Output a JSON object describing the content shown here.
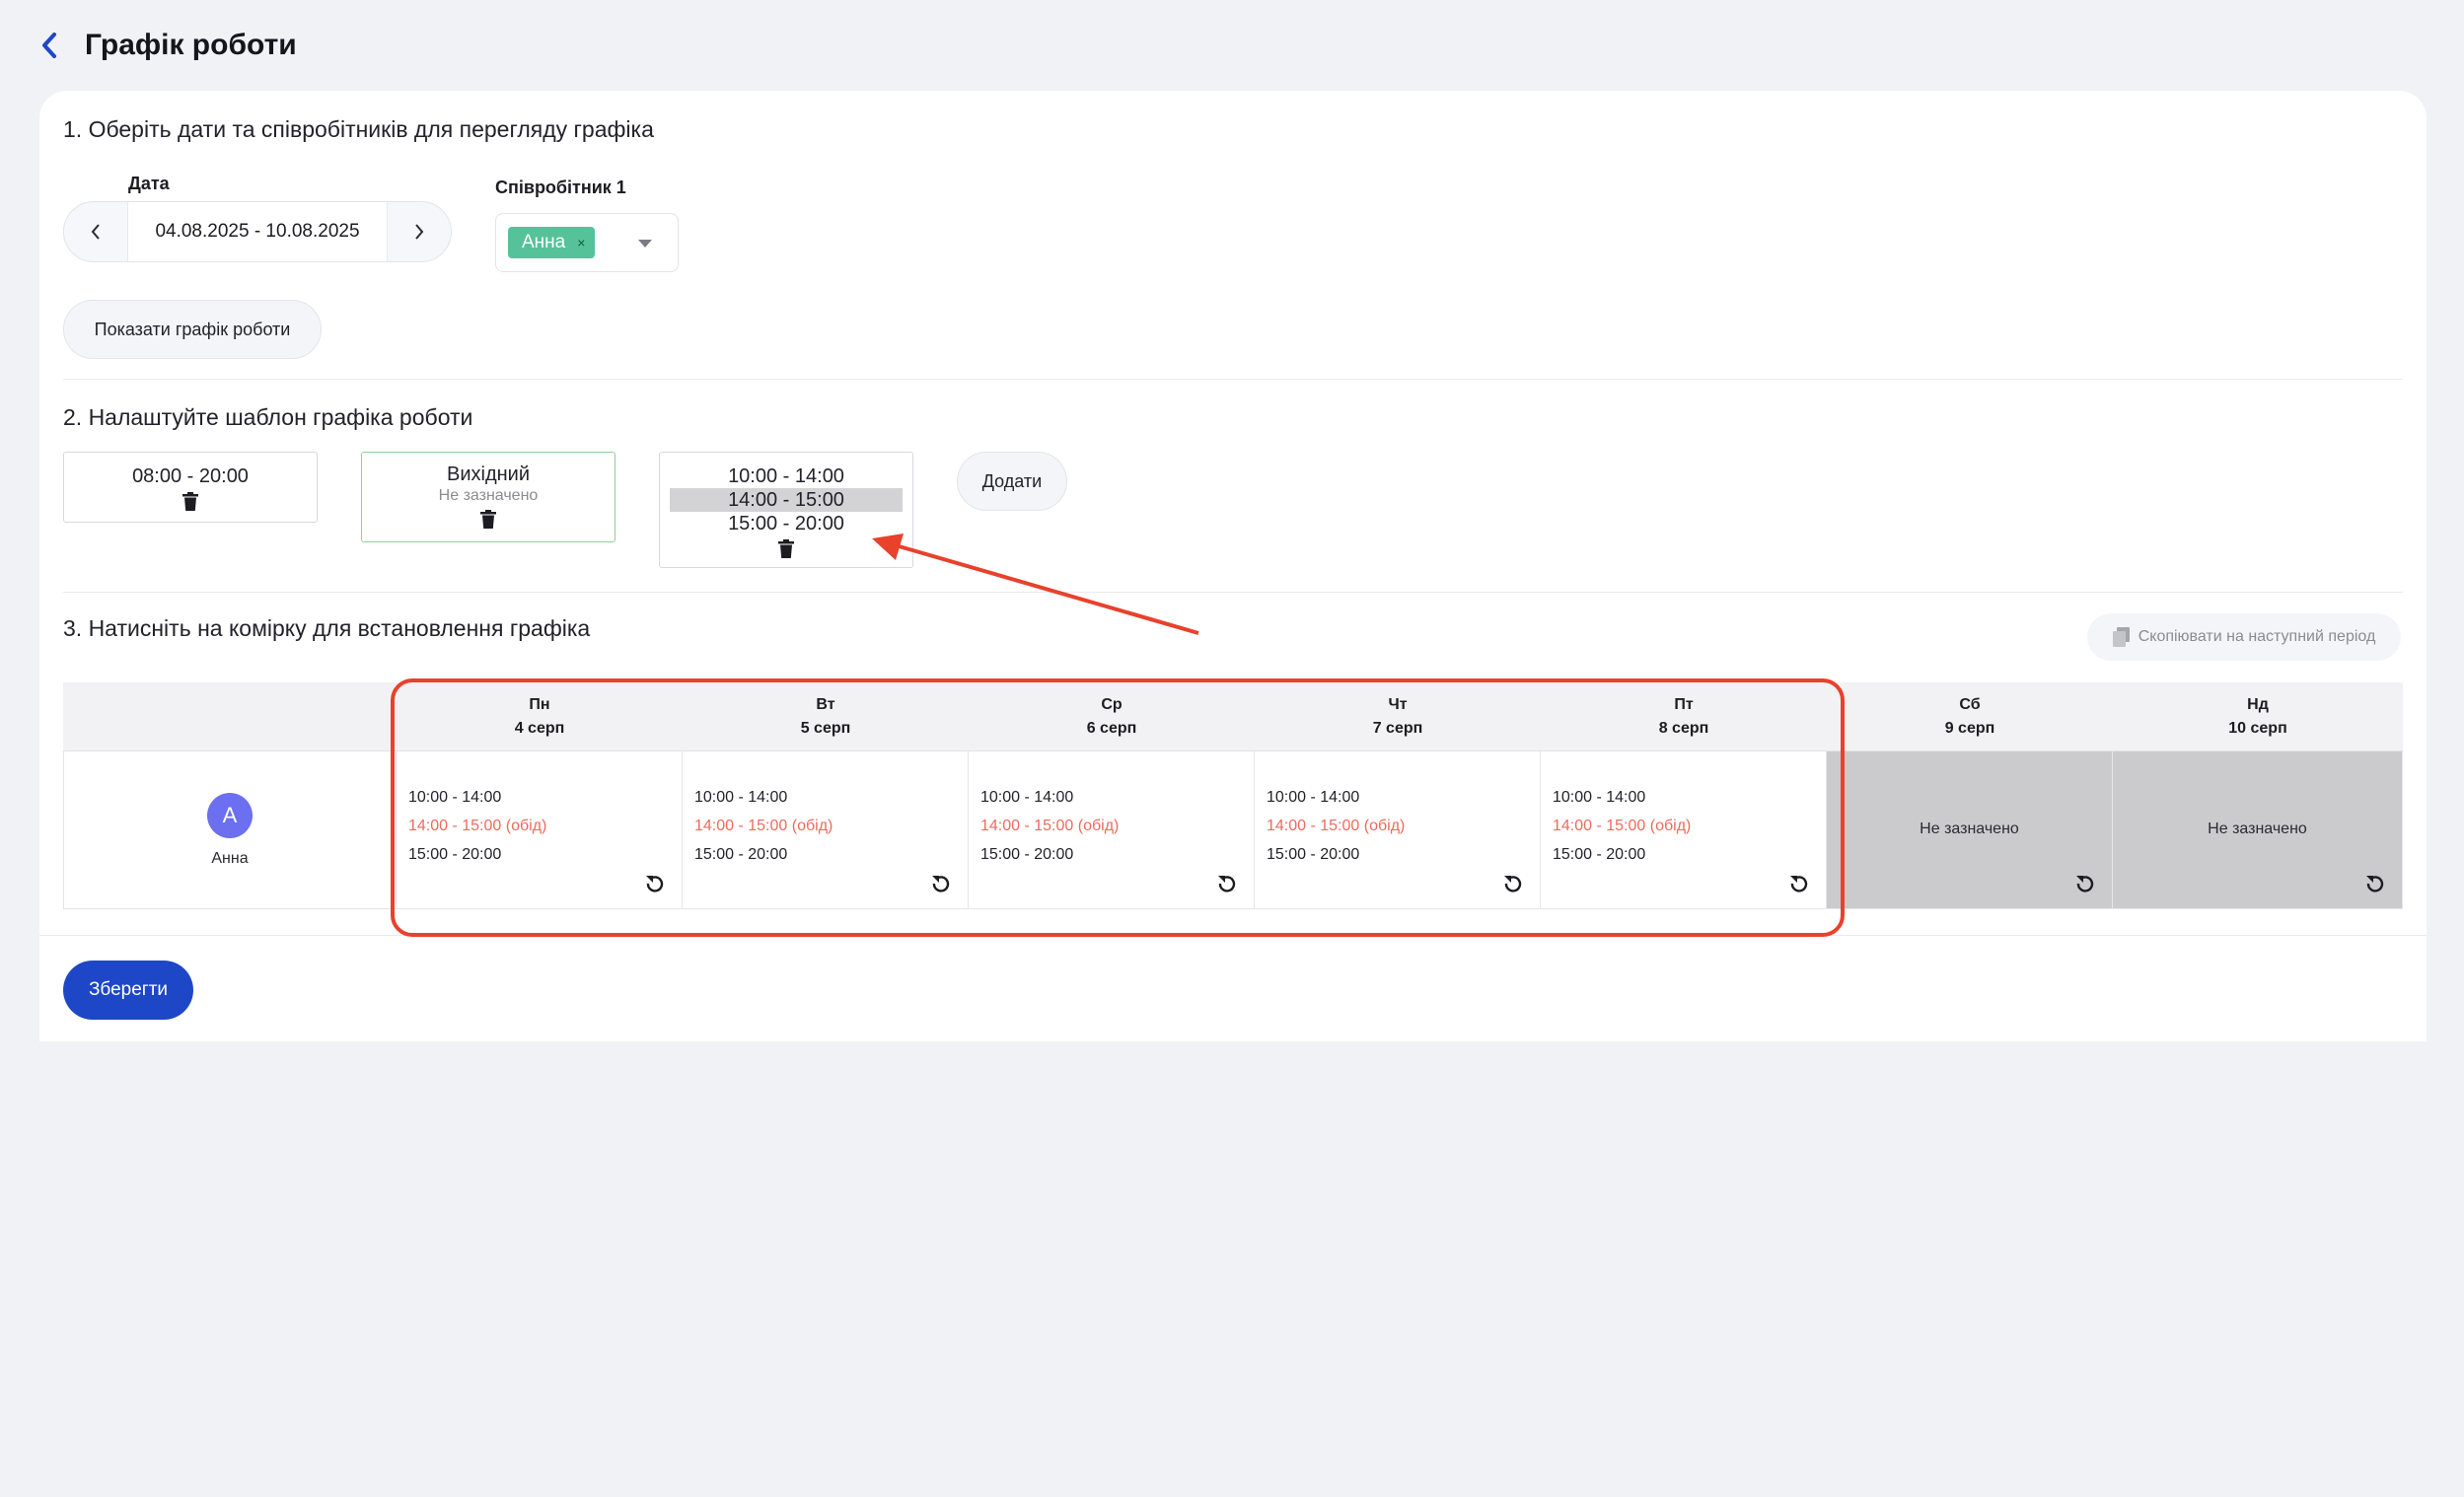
{
  "header": {
    "title": "Графік роботи"
  },
  "step1": {
    "title": "1. Оберіть дати та співробітників для перегляду графіка",
    "date_label": "Дата",
    "date_range": "04.08.2025 - 10.08.2025",
    "employee_label": "Співробітник 1",
    "employee_chip": "Анна",
    "chip_remove": "×",
    "show_button": "Показати графік роботи"
  },
  "step2": {
    "title": "2. Налаштуйте шаблон графіка роботи",
    "templates": [
      {
        "lines": [
          "08:00 - 20:00"
        ]
      },
      {
        "lines": [
          "Вихідний"
        ],
        "sub": "Не зазначено"
      },
      {
        "lines": [
          "10:00 - 14:00",
          "14:00 - 15:00",
          "15:00 - 20:00"
        ]
      }
    ],
    "add_button": "Додати"
  },
  "step3": {
    "title": "3. Натисніть на комірку для встановлення графіка",
    "copy_button": "Скопіювати на наступний період",
    "days": [
      {
        "day": "Пн",
        "date": "4 серп"
      },
      {
        "day": "Вт",
        "date": "5 серп"
      },
      {
        "day": "Ср",
        "date": "6 серп"
      },
      {
        "day": "Чт",
        "date": "7 серп"
      },
      {
        "day": "Пт",
        "date": "8 серп"
      },
      {
        "day": "Сб",
        "date": "9 серп"
      },
      {
        "day": "Нд",
        "date": "10 серп"
      }
    ],
    "employee": {
      "initial": "А",
      "name": "Анна"
    },
    "cells": [
      {
        "lines": [
          "10:00 - 14:00",
          "14:00 - 15:00 (обід)",
          "15:00 - 20:00"
        ]
      },
      {
        "lines": [
          "10:00 - 14:00",
          "14:00 - 15:00 (обід)",
          "15:00 - 20:00"
        ]
      },
      {
        "lines": [
          "10:00 - 14:00",
          "14:00 - 15:00 (обід)",
          "15:00 - 20:00"
        ]
      },
      {
        "lines": [
          "10:00 - 14:00",
          "14:00 - 15:00 (обід)",
          "15:00 - 20:00"
        ]
      },
      {
        "lines": [
          "10:00 - 14:00",
          "14:00 - 15:00 (обід)",
          "15:00 - 20:00"
        ]
      },
      {
        "off": "Не зазначено"
      },
      {
        "off": "Не зазначено"
      }
    ]
  },
  "save_button": "Зберегти",
  "colors": {
    "accent": "#1e47c8",
    "chip": "#56c29a",
    "lunch": "#ef6a5d",
    "annotation": "#e8412c",
    "off_cell": "#cbcbce",
    "avatar": "#6b6ff0"
  },
  "icons": [
    "back-chevron-icon",
    "chevron-left-icon",
    "chevron-right-icon",
    "trash-icon",
    "copy-icon",
    "reset-icon"
  ]
}
